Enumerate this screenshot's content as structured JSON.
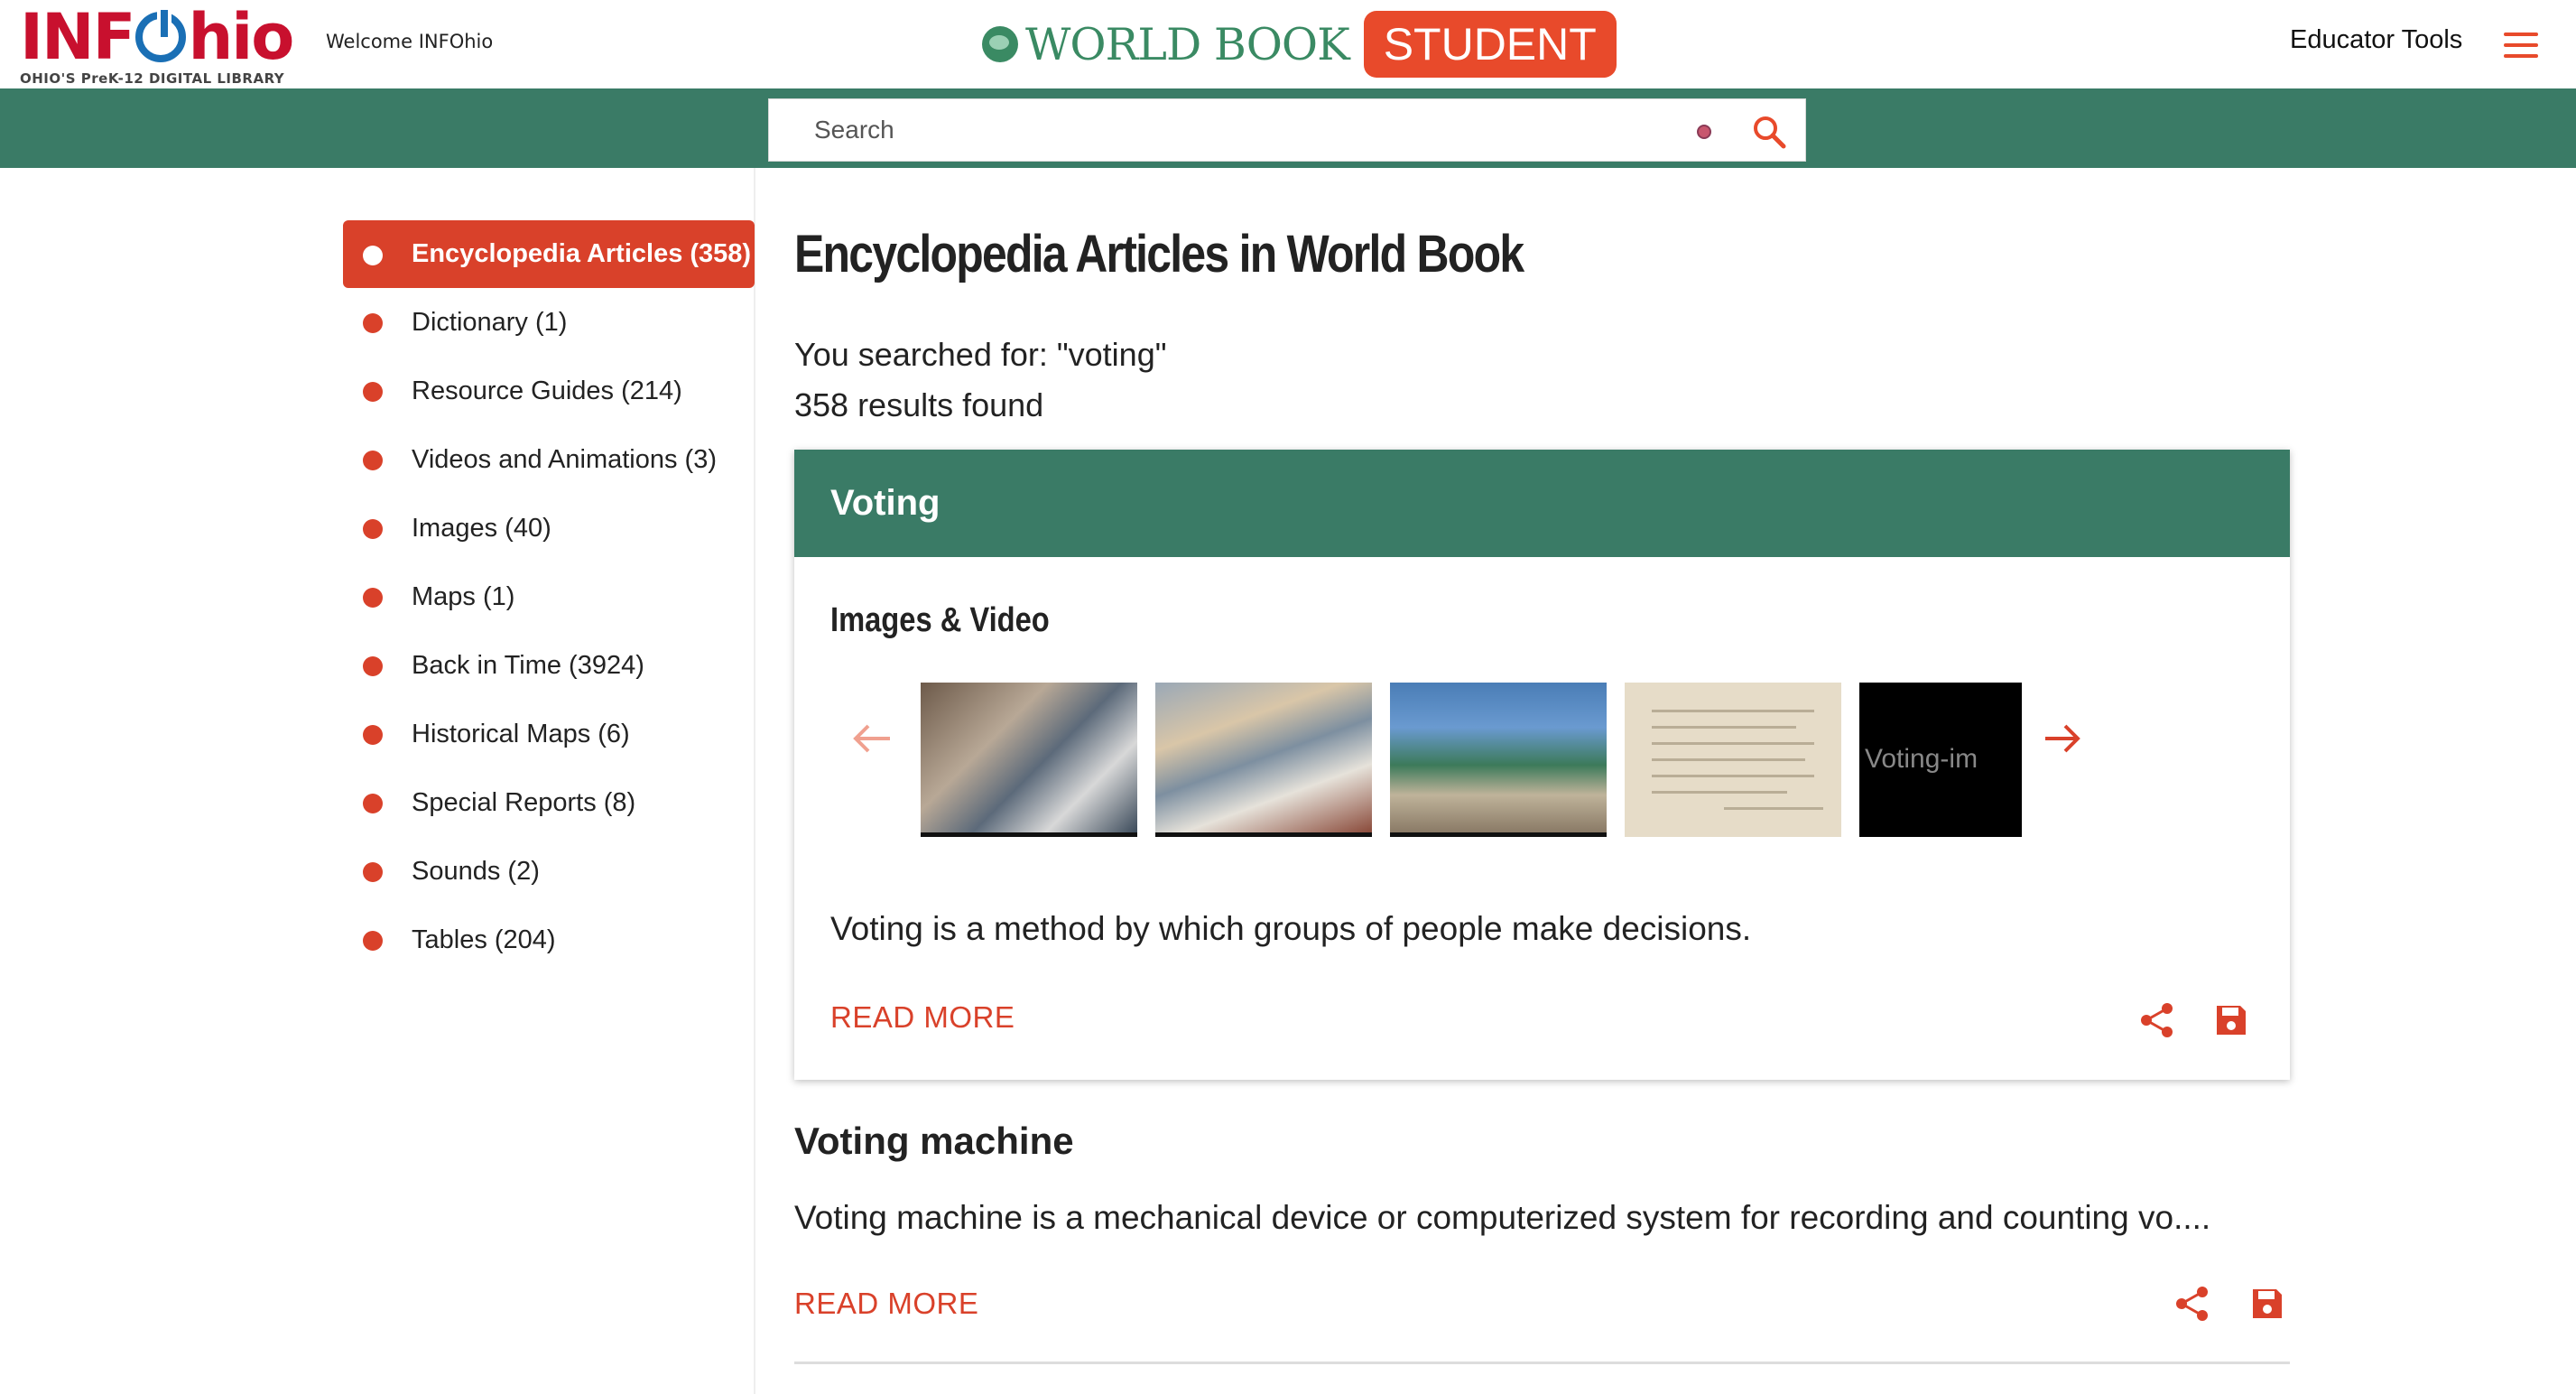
{
  "header": {
    "logo_text": "INFOhio",
    "logo_subtitle": "OHIO'S PreK-12 DIGITAL LIBRARY",
    "welcome": "Welcome INFOhio",
    "brand_name": "WORLD BOOK",
    "brand_badge": "STUDENT",
    "educator_tools": "Educator Tools",
    "menu_icon": "hamburger-menu-icon"
  },
  "search": {
    "placeholder": "Search",
    "value": ""
  },
  "sidebar": {
    "items": [
      {
        "label": "Encyclopedia Articles (358)",
        "active": true
      },
      {
        "label": "Dictionary (1)",
        "active": false
      },
      {
        "label": "Resource Guides (214)",
        "active": false
      },
      {
        "label": "Videos and Animations (3)",
        "active": false
      },
      {
        "label": "Images (40)",
        "active": false
      },
      {
        "label": "Maps (1)",
        "active": false
      },
      {
        "label": "Back in Time (3924)",
        "active": false
      },
      {
        "label": "Historical Maps (6)",
        "active": false
      },
      {
        "label": "Special Reports (8)",
        "active": false
      },
      {
        "label": "Sounds (2)",
        "active": false
      },
      {
        "label": "Tables (204)",
        "active": false
      }
    ]
  },
  "main": {
    "title": "Encyclopedia Articles in World Book",
    "searched_for": "You searched for: \"voting\"",
    "results_count": "358 results found",
    "featured": {
      "title": "Voting",
      "section_label": "Images & Video",
      "broken_image_alt": "Voting-im",
      "description": "Voting is a method by which groups of people make decisions.",
      "read_more": "READ MORE"
    },
    "results": [
      {
        "title": "Voting machine",
        "description": "Voting machine is a mechanical device or computerized system for recording and counting vo....",
        "read_more": "READ MORE"
      }
    ]
  },
  "colors": {
    "accent": "#d9412a",
    "header_green": "#3a7b66",
    "brand_green": "#3a8a63",
    "badge": "#e84a2b",
    "logo_red": "#c8102e"
  }
}
